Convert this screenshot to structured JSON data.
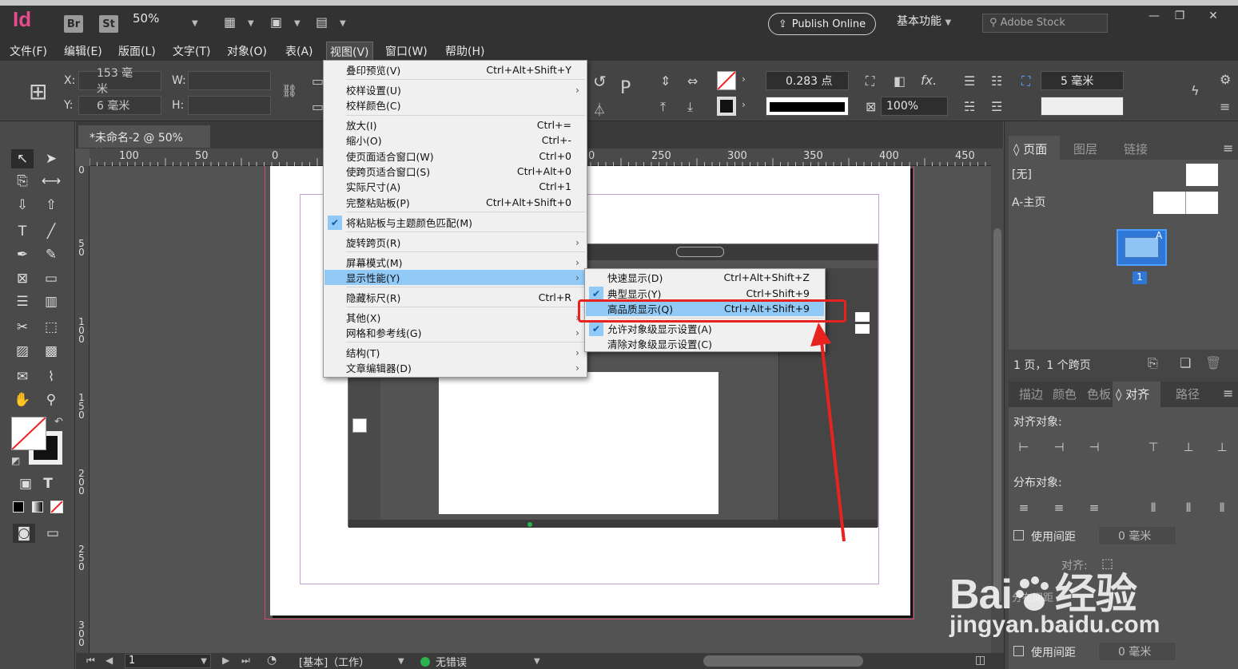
{
  "app": {
    "logo": "Id",
    "bridge": "Br",
    "stock_btn": "St",
    "zoom": "50%",
    "publish": "Publish Online",
    "workspace": "基本功能",
    "search_placeholder": "Adobe Stock"
  },
  "menubar": [
    "文件(F)",
    "编辑(E)",
    "版面(L)",
    "文字(T)",
    "对象(O)",
    "表(A)",
    "视图(V)",
    "窗口(W)",
    "帮助(H)"
  ],
  "control": {
    "x_label": "X:",
    "x_value": "153 毫米",
    "y_label": "Y:",
    "y_value": "6 毫米",
    "w_label": "W:",
    "h_label": "H:",
    "stroke_weight": "0.283 点",
    "opacity": "100%",
    "spacing": "5 毫米",
    "fx": "fx."
  },
  "doc_tab": {
    "title": "*未命名-2 @ 50%",
    "close": "×"
  },
  "ruler_h": [
    "100",
    "50",
    "0",
    "50",
    "250",
    "300",
    "350",
    "400",
    "450"
  ],
  "ruler_v": [
    "0",
    "5 0",
    "1 0 0",
    "1 5 0",
    "2 0 0",
    "2 5 0",
    "3 0 0"
  ],
  "view_menu": [
    {
      "label": "叠印预览(V)",
      "shortcut": "Ctrl+Alt+Shift+Y"
    },
    {
      "label": "校样设置(U)",
      "shortcut": "",
      "arrow": "›"
    },
    {
      "label": "校样颜色(C)",
      "shortcut": ""
    },
    {
      "label": "放大(I)",
      "shortcut": "Ctrl+="
    },
    {
      "label": "缩小(O)",
      "shortcut": "Ctrl+-"
    },
    {
      "label": "使页面适合窗口(W)",
      "shortcut": "Ctrl+0"
    },
    {
      "label": "使跨页适合窗口(S)",
      "shortcut": "Ctrl+Alt+0"
    },
    {
      "label": "实际尺寸(A)",
      "shortcut": "Ctrl+1"
    },
    {
      "label": "完整粘贴板(P)",
      "shortcut": "Ctrl+Alt+Shift+0"
    },
    {
      "label": "将粘贴板与主题颜色匹配(M)",
      "shortcut": ""
    },
    {
      "label": "旋转跨页(R)",
      "shortcut": "",
      "arrow": "›"
    },
    {
      "label": "屏幕模式(M)",
      "shortcut": "",
      "arrow": "›"
    },
    {
      "label": "显示性能(Y)",
      "shortcut": "",
      "arrow": "›"
    },
    {
      "label": "隐藏标尺(R)",
      "shortcut": "Ctrl+R"
    },
    {
      "label": "其他(X)",
      "shortcut": "",
      "arrow": "›"
    },
    {
      "label": "网格和参考线(G)",
      "shortcut": "",
      "arrow": "›"
    },
    {
      "label": "结构(T)",
      "shortcut": "",
      "arrow": "›"
    },
    {
      "label": "文章编辑器(D)",
      "shortcut": "",
      "arrow": "›"
    }
  ],
  "display_menu": [
    {
      "label": "快速显示(D)",
      "shortcut": "Ctrl+Alt+Shift+Z"
    },
    {
      "label": "典型显示(Y)",
      "shortcut": "Ctrl+Shift+9"
    },
    {
      "label": "高品质显示(Q)",
      "shortcut": "Ctrl+Alt+Shift+9"
    },
    {
      "label": "允许对象级显示设置(A)",
      "shortcut": ""
    },
    {
      "label": "清除对象级显示设置(C)",
      "shortcut": ""
    }
  ],
  "pages_panel": {
    "tabs": [
      "页面",
      "图层",
      "链接"
    ],
    "none": "[无]",
    "master": "A-主页",
    "page_num": "1",
    "master_letter": "A",
    "summary": "1 页，1 个跨页"
  },
  "align_panel": {
    "tabs": [
      "描边",
      "颜色",
      "色板",
      "对齐",
      "路径"
    ],
    "align_objects": "对齐对象:",
    "distribute_objects": "分布对象:",
    "use_spacing": "使用间距",
    "spacing_value": "0 毫米",
    "align_to": "对齐:",
    "distribute_spacing": "分布间距"
  },
  "status": {
    "page": "1",
    "mode": "[基本]（工作）",
    "errors": "无错误"
  },
  "watermark": {
    "brand": "Bai",
    "brand2": "经验",
    "url": "jingyan.baidu.com"
  },
  "colors": {
    "accent": "#91c9f7",
    "highlight_box": "#e8231f",
    "logo": "#ea4b8f",
    "ok": "#2bb24c"
  }
}
